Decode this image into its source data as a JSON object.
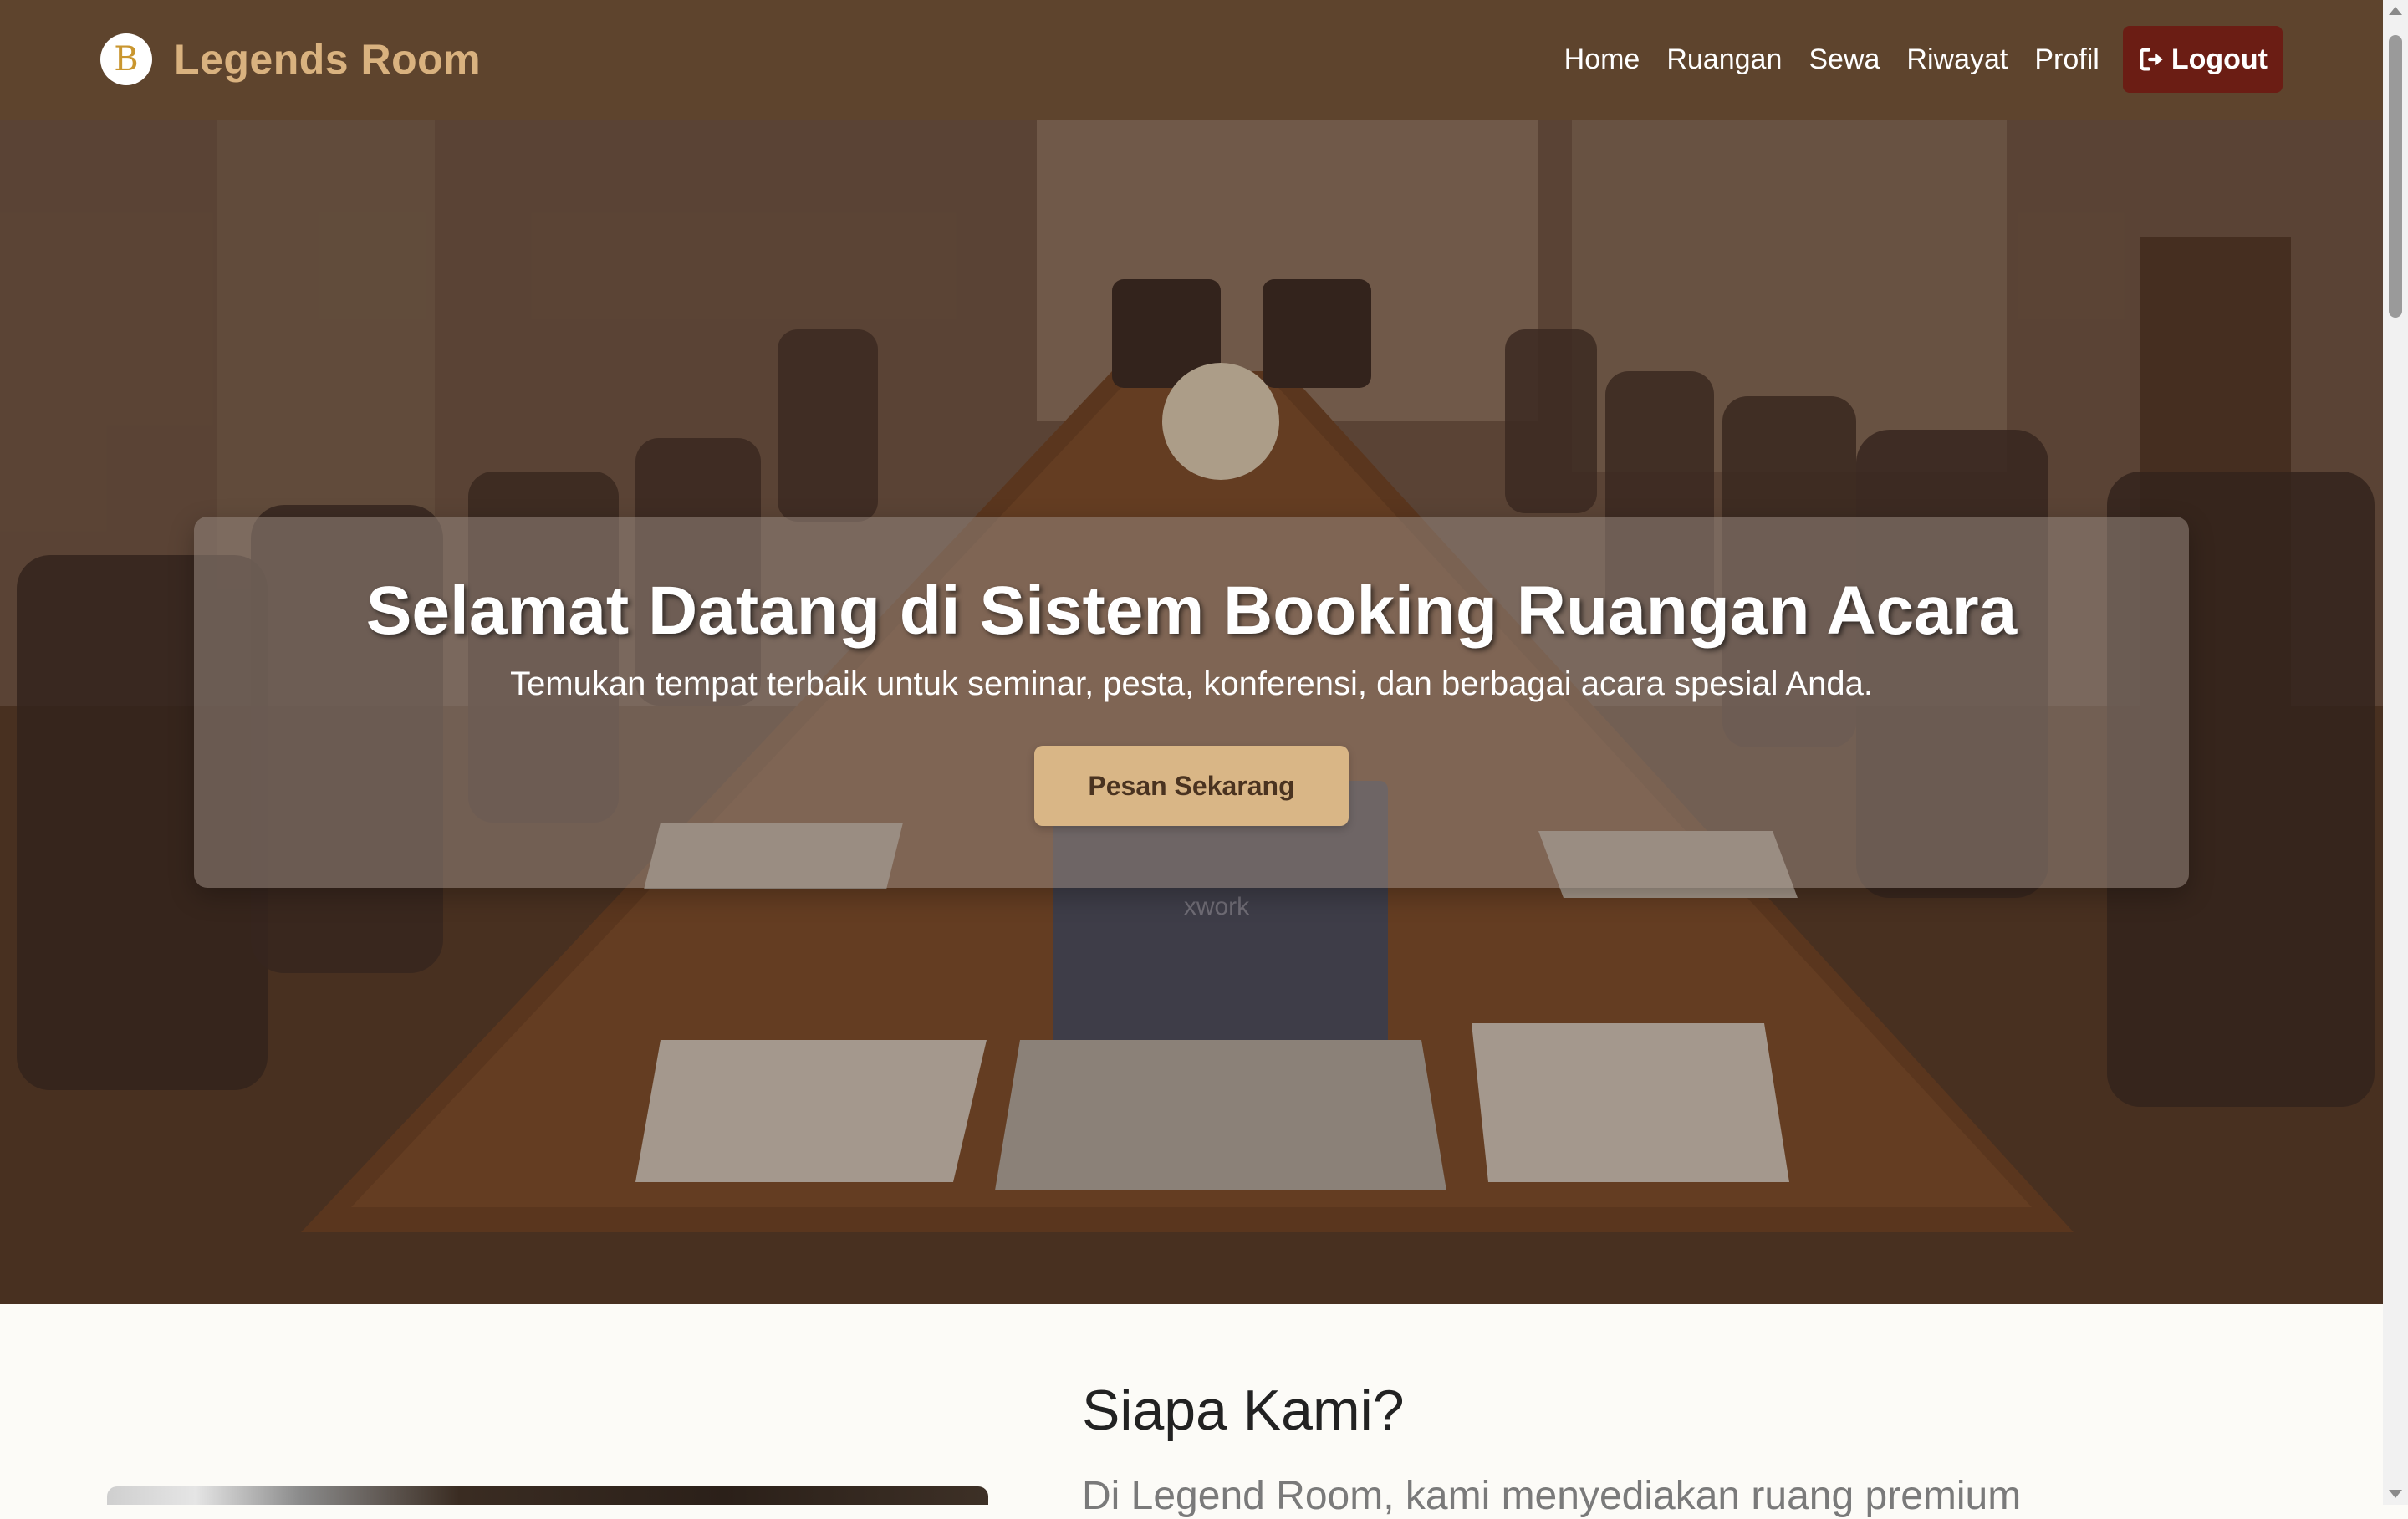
{
  "navbar": {
    "logo_letter": "B",
    "brand": "Legends Room",
    "links": [
      "Home",
      "Ruangan",
      "Sewa",
      "Riwayat",
      "Profil"
    ],
    "logout_label": "Logout",
    "logout_icon": "sign-out-icon"
  },
  "hero": {
    "title": "Selamat Datang di Sistem Booking Ruangan Acara",
    "subtitle": "Temukan tempat terbaik untuk seminar, pesta, konferensi, dan berbagai acara spesial Anda.",
    "cta_label": "Pesan Sekarang",
    "laptop_text": "xwork"
  },
  "about": {
    "title": "Siapa Kami?",
    "text": "Di Legend Room, kami menyediakan ruang premium"
  },
  "colors": {
    "navbar": "#5e442d",
    "brand": "#d9b27f",
    "logout": "#6b1d14",
    "cta": "#d9b686",
    "page_bg": "#fcfbf7"
  }
}
